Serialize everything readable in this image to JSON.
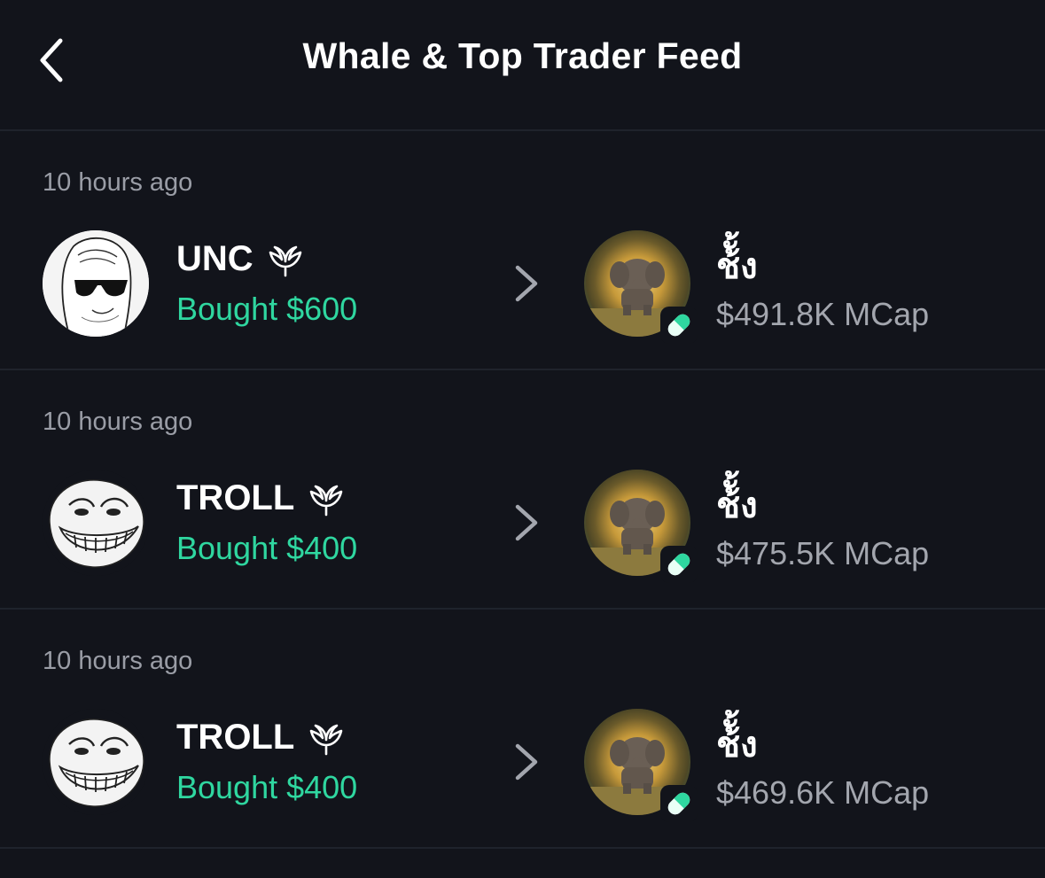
{
  "header": {
    "title": "Whale & Top Trader Feed",
    "back_icon": "chevron-left-icon"
  },
  "colors": {
    "background": "#12141b",
    "divider": "#1f232c",
    "bought_green": "#2fd7a0",
    "secondary_text": "#9a9da6",
    "pill_green": "#2fd7a0"
  },
  "feed": [
    {
      "time": "10 hours ago",
      "trader": {
        "name": "UNC",
        "avatar": "wojak-sunglasses-avatar",
        "badge_icon": "whale-icon"
      },
      "action": "Bought $600",
      "token": {
        "name": "ช้ั้ง",
        "mcap": "$491.8K MCap",
        "avatar": "elephant-avatar",
        "badge_icon": "pill-icon"
      }
    },
    {
      "time": "10 hours ago",
      "trader": {
        "name": "TROLL",
        "avatar": "trollface-avatar",
        "badge_icon": "whale-icon"
      },
      "action": "Bought $400",
      "token": {
        "name": "ช้ั้ง",
        "mcap": "$475.5K MCap",
        "avatar": "elephant-avatar",
        "badge_icon": "pill-icon"
      }
    },
    {
      "time": "10 hours ago",
      "trader": {
        "name": "TROLL",
        "avatar": "trollface-avatar",
        "badge_icon": "whale-icon"
      },
      "action": "Bought $400",
      "token": {
        "name": "ช้ั้ง",
        "mcap": "$469.6K MCap",
        "avatar": "elephant-avatar",
        "badge_icon": "pill-icon"
      }
    }
  ]
}
